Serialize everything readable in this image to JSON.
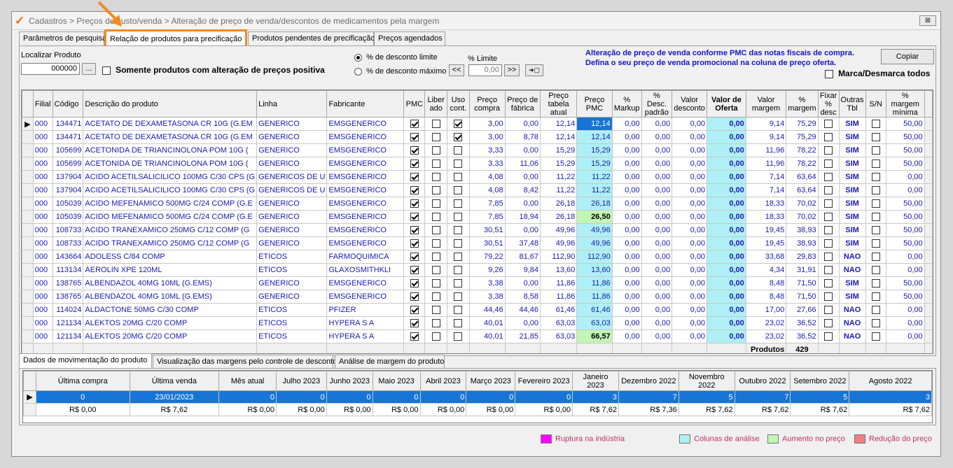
{
  "window": {
    "title": "Cadastros > Preços de custo/venda > Alteração de preço de venda/descontos de medicamentos pela margem",
    "close_label": "⊠"
  },
  "colors": {
    "highlight": "#f58a1f",
    "info_text": "#1515c8",
    "selection": "#1675d6"
  },
  "tabs": [
    "Parâmetros de pesquisa",
    "Relação de produtos para precificação",
    "Produtos pendentes de precificação",
    "Preços agendados"
  ],
  "toolbar": {
    "localizar_label": "Localizar Produto",
    "localizar_value": "000000",
    "dots_label": "...",
    "somente_label": "Somente produtos com alteração de preços positiva",
    "radio1_label": "% de desconto limite",
    "radio2_label": "% de desconto máximo",
    "limite_label": "% Limite",
    "limite_value": "0,00",
    "prev_label": "<<",
    "next_label": ">>",
    "apply_label": "➜▢",
    "info_line1": "Alteração de preço de venda conforme PMC das notas fiscais de compra.",
    "info_line2": "Defina o seu preço de venda promocional na coluna de preço oferta.",
    "copiar_label": "Copiar",
    "marca_label": "Marca/Desmarca todos"
  },
  "grid": {
    "headers": [
      "Filial",
      "Código",
      "Descrição do produto",
      "Linha",
      "Fabricante",
      "PMC",
      "Liber ado",
      "Uso cont.",
      "Preço compra",
      "Preço de fábrica",
      "Preço tabela atual",
      "Preço PMC",
      "% Markup",
      "% Desc. padrão",
      "Valor desconto",
      "Valor de Oferta",
      "Valor margem",
      "% margem",
      "Fixar % desc",
      "Outras Tbl",
      "S/N",
      "% margem mínima"
    ],
    "rows": [
      {
        "filial": "000",
        "codigo": "134471",
        "descricao": "ACETATO DE DEXAMETASONA CR 10G (G.EM",
        "linha": "GENERICO",
        "fabricante": "EMSGENERICO",
        "pmc": true,
        "liberado": false,
        "uso": true,
        "compra": "3,00",
        "fabrica": "0,00",
        "tabela": "12,14",
        "precopmc": "12,14",
        "markup": "0,00",
        "desc": "0,00",
        "valdesc": "0,00",
        "oferta": "0,00",
        "valmargem": "9,14",
        "margem": "75,29",
        "fixar": false,
        "outras": "SIM",
        "sn": false,
        "minima": "50,00",
        "pmc_state": "sel"
      },
      {
        "filial": "000",
        "codigo": "134471",
        "descricao": "ACETATO DE DEXAMETASONA CR 10G (G.EM",
        "linha": "GENERICO",
        "fabricante": "EMSGENERICO",
        "pmc": true,
        "liberado": false,
        "uso": true,
        "compra": "3,00",
        "fabrica": "8,78",
        "tabela": "12,14",
        "precopmc": "12,14",
        "markup": "0,00",
        "desc": "0,00",
        "valdesc": "0,00",
        "oferta": "0,00",
        "valmargem": "9,14",
        "margem": "75,29",
        "fixar": false,
        "outras": "SIM",
        "sn": false,
        "minima": "50,00",
        "pmc_state": ""
      },
      {
        "filial": "000",
        "codigo": "105699",
        "descricao": "ACETONIDA DE TRIANCINOLONA POM 10G (",
        "linha": "GENERICO",
        "fabricante": "EMSGENERICO",
        "pmc": true,
        "liberado": false,
        "uso": false,
        "compra": "3,33",
        "fabrica": "0,00",
        "tabela": "15,29",
        "precopmc": "15,29",
        "markup": "0,00",
        "desc": "0,00",
        "valdesc": "0,00",
        "oferta": "0,00",
        "valmargem": "11,96",
        "margem": "78,22",
        "fixar": false,
        "outras": "SIM",
        "sn": false,
        "minima": "50,00",
        "pmc_state": ""
      },
      {
        "filial": "000",
        "codigo": "105699",
        "descricao": "ACETONIDA DE TRIANCINOLONA POM 10G (",
        "linha": "GENERICO",
        "fabricante": "EMSGENERICO",
        "pmc": true,
        "liberado": false,
        "uso": false,
        "compra": "3,33",
        "fabrica": "11,06",
        "tabela": "15,29",
        "precopmc": "15,29",
        "markup": "0,00",
        "desc": "0,00",
        "valdesc": "0,00",
        "oferta": "0,00",
        "valmargem": "11,96",
        "margem": "78,22",
        "fixar": false,
        "outras": "SIM",
        "sn": false,
        "minima": "50,00",
        "pmc_state": ""
      },
      {
        "filial": "000",
        "codigo": "137904",
        "descricao": "ACIDO ACETILSALICILICO 100MG C/30 CPS (G",
        "linha": "GENERICOS DE U",
        "fabricante": "EMSGENERICO",
        "pmc": true,
        "liberado": false,
        "uso": false,
        "compra": "4,08",
        "fabrica": "0,00",
        "tabela": "11,22",
        "precopmc": "11,22",
        "markup": "0,00",
        "desc": "0,00",
        "valdesc": "0,00",
        "oferta": "0,00",
        "valmargem": "7,14",
        "margem": "63,64",
        "fixar": false,
        "outras": "SIM",
        "sn": false,
        "minima": "0,00",
        "pmc_state": ""
      },
      {
        "filial": "000",
        "codigo": "137904",
        "descricao": "ACIDO ACETILSALICILICO 100MG C/30 CPS (G",
        "linha": "GENERICOS DE U",
        "fabricante": "EMSGENERICO",
        "pmc": true,
        "liberado": false,
        "uso": false,
        "compra": "4,08",
        "fabrica": "8,42",
        "tabela": "11,22",
        "precopmc": "11,22",
        "markup": "0,00",
        "desc": "0,00",
        "valdesc": "0,00",
        "oferta": "0,00",
        "valmargem": "7,14",
        "margem": "63,64",
        "fixar": false,
        "outras": "SIM",
        "sn": false,
        "minima": "0,00",
        "pmc_state": ""
      },
      {
        "filial": "000",
        "codigo": "105039",
        "descricao": "ACIDO MEFENAMICO 500MG C/24 COMP (G.E",
        "linha": "GENERICO",
        "fabricante": "EMSGENERICO",
        "pmc": true,
        "liberado": false,
        "uso": false,
        "compra": "7,85",
        "fabrica": "0,00",
        "tabela": "26,18",
        "precopmc": "26,18",
        "markup": "0,00",
        "desc": "0,00",
        "valdesc": "0,00",
        "oferta": "0,00",
        "valmargem": "18,33",
        "margem": "70,02",
        "fixar": false,
        "outras": "SIM",
        "sn": false,
        "minima": "50,00",
        "pmc_state": ""
      },
      {
        "filial": "000",
        "codigo": "105039",
        "descricao": "ACIDO MEFENAMICO 500MG C/24 COMP (G.E",
        "linha": "GENERICO",
        "fabricante": "EMSGENERICO",
        "pmc": true,
        "liberado": false,
        "uso": false,
        "compra": "7,85",
        "fabrica": "18,94",
        "tabela": "26,18",
        "precopmc": "26,50",
        "markup": "0,00",
        "desc": "0,00",
        "valdesc": "0,00",
        "oferta": "0,00",
        "valmargem": "18,33",
        "margem": "70,02",
        "fixar": false,
        "outras": "SIM",
        "sn": false,
        "minima": "50,00",
        "pmc_state": "up"
      },
      {
        "filial": "000",
        "codigo": "108733",
        "descricao": "ACIDO TRANEXAMICO 250MG C/12 COMP (G",
        "linha": "GENERICO",
        "fabricante": "EMSGENERICO",
        "pmc": true,
        "liberado": false,
        "uso": false,
        "compra": "30,51",
        "fabrica": "0,00",
        "tabela": "49,96",
        "precopmc": "49,96",
        "markup": "0,00",
        "desc": "0,00",
        "valdesc": "0,00",
        "oferta": "0,00",
        "valmargem": "19,45",
        "margem": "38,93",
        "fixar": false,
        "outras": "SIM",
        "sn": false,
        "minima": "50,00",
        "pmc_state": ""
      },
      {
        "filial": "000",
        "codigo": "108733",
        "descricao": "ACIDO TRANEXAMICO 250MG C/12 COMP (G",
        "linha": "GENERICO",
        "fabricante": "EMSGENERICO",
        "pmc": true,
        "liberado": false,
        "uso": false,
        "compra": "30,51",
        "fabrica": "37,48",
        "tabela": "49,96",
        "precopmc": "49,96",
        "markup": "0,00",
        "desc": "0,00",
        "valdesc": "0,00",
        "oferta": "0,00",
        "valmargem": "19,45",
        "margem": "38,93",
        "fixar": false,
        "outras": "SIM",
        "sn": false,
        "minima": "50,00",
        "pmc_state": ""
      },
      {
        "filial": "000",
        "codigo": "143664",
        "descricao": "ADOLESS C/84 COMP",
        "linha": "ETICOS",
        "fabricante": "FARMOQUIMICA",
        "pmc": true,
        "liberado": false,
        "uso": false,
        "compra": "79,22",
        "fabrica": "81,67",
        "tabela": "112,90",
        "precopmc": "112,90",
        "markup": "0,00",
        "desc": "0,00",
        "valdesc": "0,00",
        "oferta": "0,00",
        "valmargem": "33,68",
        "margem": "29,83",
        "fixar": false,
        "outras": "NAO",
        "sn": false,
        "minima": "0,00",
        "pmc_state": ""
      },
      {
        "filial": "000",
        "codigo": "113134",
        "descricao": "AEROLIN XPE 120ML",
        "linha": "ETICOS",
        "fabricante": "GLAXOSMITHKLI",
        "pmc": true,
        "liberado": false,
        "uso": false,
        "compra": "9,26",
        "fabrica": "9,84",
        "tabela": "13,60",
        "precopmc": "13,60",
        "markup": "0,00",
        "desc": "0,00",
        "valdesc": "0,00",
        "oferta": "0,00",
        "valmargem": "4,34",
        "margem": "31,91",
        "fixar": false,
        "outras": "NAO",
        "sn": false,
        "minima": "0,00",
        "pmc_state": ""
      },
      {
        "filial": "000",
        "codigo": "138765",
        "descricao": "ALBENDAZOL 40MG 10ML (G.EMS)",
        "linha": "GENERICO",
        "fabricante": "EMSGENERICO",
        "pmc": true,
        "liberado": false,
        "uso": false,
        "compra": "3,38",
        "fabrica": "0,00",
        "tabela": "11,86",
        "precopmc": "11,86",
        "markup": "0,00",
        "desc": "0,00",
        "valdesc": "0,00",
        "oferta": "0,00",
        "valmargem": "8,48",
        "margem": "71,50",
        "fixar": false,
        "outras": "SIM",
        "sn": false,
        "minima": "50,00",
        "pmc_state": ""
      },
      {
        "filial": "000",
        "codigo": "138765",
        "descricao": "ALBENDAZOL 40MG 10ML (G.EMS)",
        "linha": "GENERICO",
        "fabricante": "EMSGENERICO",
        "pmc": true,
        "liberado": false,
        "uso": false,
        "compra": "3,38",
        "fabrica": "8,58",
        "tabela": "11,86",
        "precopmc": "11,86",
        "markup": "0,00",
        "desc": "0,00",
        "valdesc": "0,00",
        "oferta": "0,00",
        "valmargem": "8,48",
        "margem": "71,50",
        "fixar": false,
        "outras": "SIM",
        "sn": false,
        "minima": "50,00",
        "pmc_state": ""
      },
      {
        "filial": "000",
        "codigo": "114024",
        "descricao": "ALDACTONE 50MG C/30 COMP",
        "linha": "ETICOS",
        "fabricante": "PFIZER",
        "pmc": true,
        "liberado": false,
        "uso": false,
        "compra": "44,46",
        "fabrica": "44,46",
        "tabela": "61,46",
        "precopmc": "61,46",
        "markup": "0,00",
        "desc": "0,00",
        "valdesc": "0,00",
        "oferta": "0,00",
        "valmargem": "17,00",
        "margem": "27,66",
        "fixar": false,
        "outras": "NAO",
        "sn": false,
        "minima": "0,00",
        "pmc_state": ""
      },
      {
        "filial": "000",
        "codigo": "121134",
        "descricao": "ALEKTOS 20MG C/20 COMP",
        "linha": "ETICOS",
        "fabricante": "HYPERA S A",
        "pmc": true,
        "liberado": false,
        "uso": false,
        "compra": "40,01",
        "fabrica": "0,00",
        "tabela": "63,03",
        "precopmc": "63,03",
        "markup": "0,00",
        "desc": "0,00",
        "valdesc": "0,00",
        "oferta": "0,00",
        "valmargem": "23,02",
        "margem": "36,52",
        "fixar": false,
        "outras": "NAO",
        "sn": false,
        "minima": "0,00",
        "pmc_state": ""
      },
      {
        "filial": "000",
        "codigo": "121134",
        "descricao": "ALEKTOS 20MG C/20 COMP",
        "linha": "ETICOS",
        "fabricante": "HYPERA S A",
        "pmc": true,
        "liberado": false,
        "uso": false,
        "compra": "40,01",
        "fabrica": "21,85",
        "tabela": "63,03",
        "precopmc": "66,57",
        "markup": "0,00",
        "desc": "0,00",
        "valdesc": "0,00",
        "oferta": "0,00",
        "valmargem": "23,02",
        "margem": "36,52",
        "fixar": false,
        "outras": "NAO",
        "sn": false,
        "minima": "0,00",
        "pmc_state": "up"
      }
    ],
    "footer_label": "Produtos",
    "footer_count": "429"
  },
  "tabs2": [
    "Dados de movimentação do produto",
    "Visualização das margens pelo controle de desconto",
    "Análise de margem do produto"
  ],
  "grid2": {
    "headers": [
      "Última compra",
      "Última venda",
      "Mês atual",
      "Julho 2023",
      "Junho 2023",
      "Maio 2023",
      "Abril 2023",
      "Março 2023",
      "Fevereiro 2023",
      "Janeiro 2023",
      "Dezembro 2022",
      "Novembro 2022",
      "Outubro 2022",
      "Setembro 2022",
      "Agosto 2022"
    ],
    "row1": [
      "0",
      "23/01/2023",
      "0",
      "0",
      "0",
      "0",
      "0",
      "0",
      "0",
      "3",
      "7",
      "5",
      "7",
      "5",
      "3"
    ],
    "row2": [
      "R$ 0,00",
      "R$ 7,62",
      "R$ 0,00",
      "R$ 0,00",
      "R$ 0,00",
      "R$ 0,00",
      "R$ 0,00",
      "R$ 0,00",
      "R$ 0,00",
      "R$ 7,62",
      "R$ 7,36",
      "R$ 7,62",
      "R$ 7,62",
      "R$ 7,62",
      "R$ 7,62"
    ]
  },
  "legend": [
    {
      "label": "Ruptura na indústria",
      "color": "#ff00ff"
    },
    {
      "label": "Colunas de análise",
      "color": "#aef0f5"
    },
    {
      "label": "Aumento no preço",
      "color": "#c3f5b5"
    },
    {
      "label": "Redução do preço",
      "color": "#f08080"
    }
  ]
}
